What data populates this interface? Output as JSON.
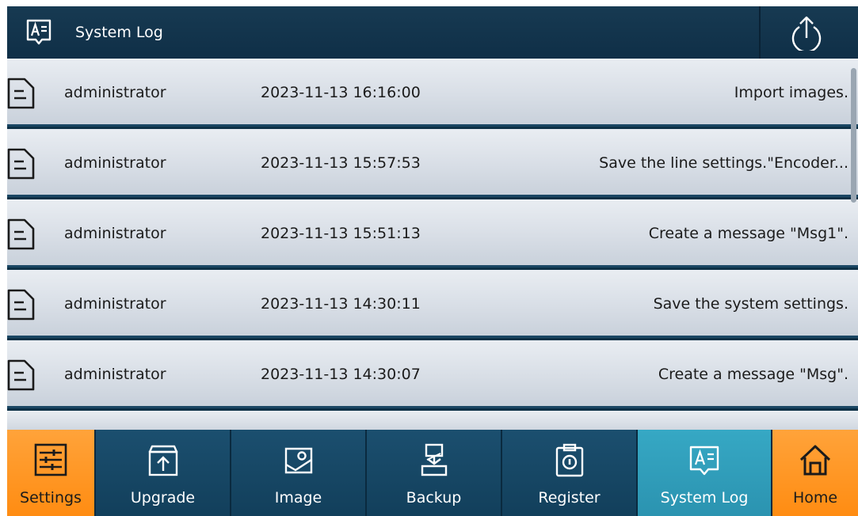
{
  "header": {
    "title": "System Log",
    "title_icon": "system-log-icon",
    "upload_icon": "upload-icon"
  },
  "log_entries": [
    {
      "user": "administrator",
      "time": "2023-11-13 16:16:00",
      "message": "Import images."
    },
    {
      "user": "administrator",
      "time": "2023-11-13 15:57:53",
      "message": "Save the line settings.\"Encoder..."
    },
    {
      "user": "administrator",
      "time": "2023-11-13 15:51:13",
      "message": "Create a message \"Msg1\"."
    },
    {
      "user": "administrator",
      "time": "2023-11-13 14:30:11",
      "message": "Save the system settings."
    },
    {
      "user": "administrator",
      "time": "2023-11-13 14:30:07",
      "message": "Create a message \"Msg\"."
    }
  ],
  "nav": {
    "settings": "Settings",
    "upgrade": "Upgrade",
    "image": "Image",
    "backup": "Backup",
    "register": "Register",
    "system_log": "System Log",
    "home": "Home"
  },
  "colors": {
    "header_bg": "#173a52",
    "nav_bg": "#1b4f6f",
    "accent_orange": "#ff8c12",
    "active_teal": "#2b93b0"
  }
}
